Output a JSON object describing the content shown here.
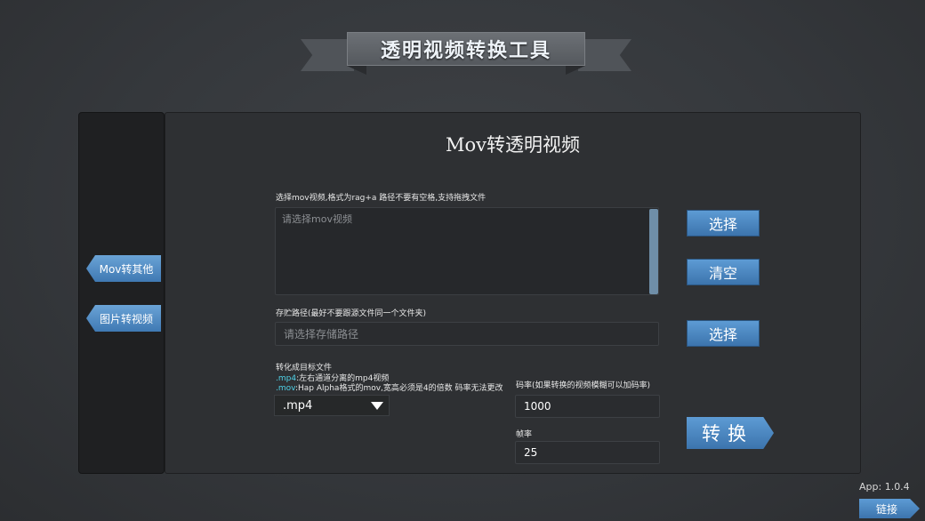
{
  "app_title": "透明视频转换工具",
  "sidebar": {
    "items": [
      {
        "label": "Mov转其他"
      },
      {
        "label": "图片转视频"
      }
    ]
  },
  "main": {
    "title": "Mov转透明视频",
    "source": {
      "label": "选择mov视频,格式为rag+a  路径不要有空格,支持拖拽文件",
      "placeholder": "请选择mov视频",
      "select_label": "选择",
      "clear_label": "清空"
    },
    "output": {
      "label": "存贮路径(最好不要跟源文件同一个文件夹)",
      "placeholder": "请选择存储路径",
      "select_label": "选择"
    },
    "target": {
      "label": "转化成目标文件",
      "mp4_key": ".mp4",
      "mp4_desc": ":左右通道分离的mp4视频",
      "mov_key": ".mov",
      "mov_desc": ":Hap Alpha格式的mov,宽高必须是4的倍数 码率无法更改",
      "selected": ".mp4"
    },
    "bitrate": {
      "label": "码率(如果转换的视频模糊可以加码率)",
      "value": "1000"
    },
    "framerate": {
      "label": "帧率",
      "value": "25"
    },
    "convert_label": "转换"
  },
  "footer": {
    "version": "App: 1.0.4",
    "link_label": "链接"
  },
  "colors": {
    "accent": "#4a86c0",
    "highlight": "#4fd2e8",
    "background": "#35383c"
  }
}
